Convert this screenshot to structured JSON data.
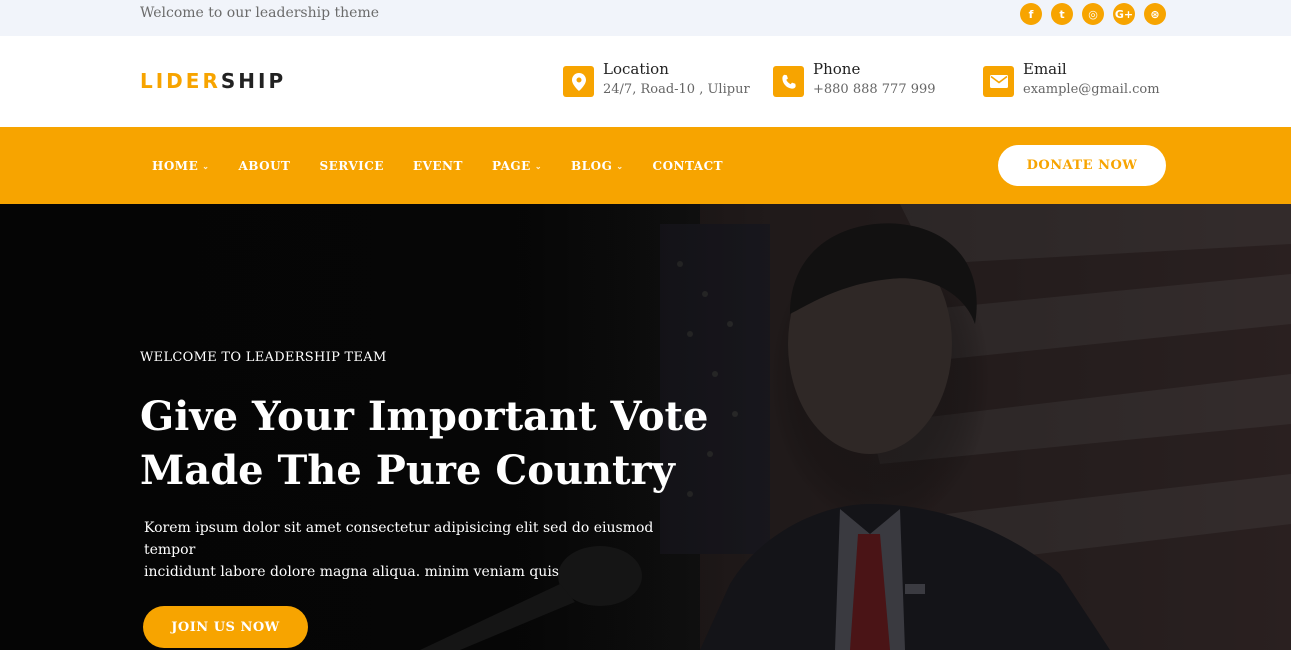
{
  "topbar": {
    "welcome": "Welcome to our leadership theme",
    "socials": [
      {
        "icon": "facebook-icon",
        "glyph": "f"
      },
      {
        "icon": "twitter-icon",
        "glyph": "t"
      },
      {
        "icon": "instagram-icon",
        "glyph": "◎"
      },
      {
        "icon": "google-plus-icon",
        "glyph": "G+"
      },
      {
        "icon": "dribbble-icon",
        "glyph": "⊛"
      }
    ]
  },
  "header": {
    "logo_part1": "LIDER",
    "logo_part2": "SHIP",
    "location": {
      "icon": "map-pin-icon",
      "title": "Location",
      "value": "24/7, Road-10 , Ulipur"
    },
    "phone": {
      "icon": "phone-icon",
      "title": "Phone",
      "value": "+880 888 777 999"
    },
    "email": {
      "icon": "envelope-icon",
      "title": "Email",
      "value": "example@gmail.com"
    }
  },
  "nav": {
    "items": [
      {
        "label": "HOME",
        "dropdown": true
      },
      {
        "label": "ABOUT",
        "dropdown": false
      },
      {
        "label": "SERVICE",
        "dropdown": false
      },
      {
        "label": "EVENT",
        "dropdown": false
      },
      {
        "label": "PAGE",
        "dropdown": true
      },
      {
        "label": "BLOG",
        "dropdown": true
      },
      {
        "label": "CONTACT",
        "dropdown": false
      }
    ],
    "donate_label": "DONATE NOW"
  },
  "hero": {
    "subtitle": "WELCOME TO LEADERSHIP TEAM",
    "headline_line1": "Give Your Important Vote",
    "headline_line2": "Made The Pure Country",
    "paragraph_line1": "Korem ipsum dolor sit amet consectetur adipisicing elit sed do eiusmod tempor",
    "paragraph_line2": "incididunt labore dolore magna aliqua. minim veniam quis",
    "cta_label": "JOIN US NOW"
  },
  "colors": {
    "accent": "#f7a400",
    "topbar_bg": "#f1f4fa",
    "hero_bg": "#050505"
  }
}
